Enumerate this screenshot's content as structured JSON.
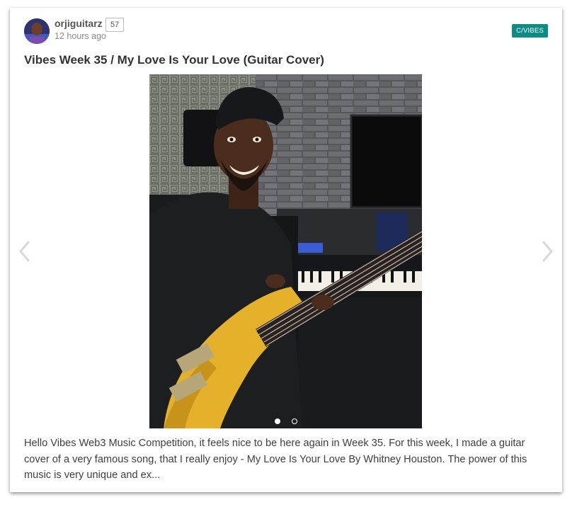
{
  "post": {
    "author": "orjiguitarz",
    "reputation": "57",
    "timestamp": "12 hours ago",
    "community": "C/VIBES",
    "title": "Vibes Week 35 / My Love Is Your Love (Guitar Cover)",
    "excerpt": "Hello Vibes Web3 Music Competition, it feels nice to be here again in Week 35. For this week, I made a guitar cover of a very famous song, that I really enjoy - My Love Is Your Love By Whitney Houston. The power of this music is very unique and ex..."
  },
  "carousel": {
    "slide_count": 2,
    "active_slide": 1,
    "prev_icon": "chevron-left-icon",
    "next_icon": "chevron-right-icon"
  },
  "colors": {
    "community_tag_bg": "#0d8c86",
    "bass_body": "#e5b12a",
    "text": "#3e3e3e",
    "muted": "#8a8a8a"
  }
}
